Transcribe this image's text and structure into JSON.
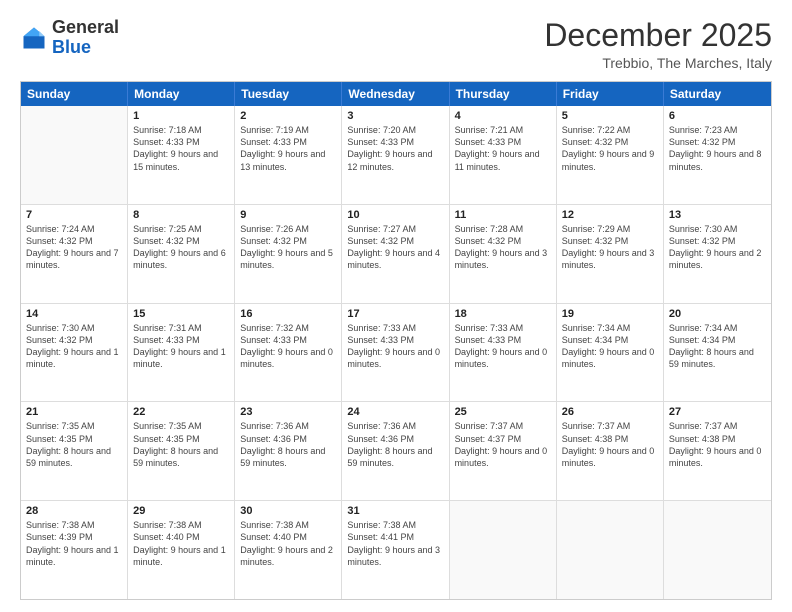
{
  "logo": {
    "general": "General",
    "blue": "Blue"
  },
  "header": {
    "month": "December 2025",
    "location": "Trebbio, The Marches, Italy"
  },
  "weekdays": [
    "Sunday",
    "Monday",
    "Tuesday",
    "Wednesday",
    "Thursday",
    "Friday",
    "Saturday"
  ],
  "weeks": [
    [
      {
        "day": "",
        "sunrise": "",
        "sunset": "",
        "daylight": ""
      },
      {
        "day": "1",
        "sunrise": "Sunrise: 7:18 AM",
        "sunset": "Sunset: 4:33 PM",
        "daylight": "Daylight: 9 hours and 15 minutes."
      },
      {
        "day": "2",
        "sunrise": "Sunrise: 7:19 AM",
        "sunset": "Sunset: 4:33 PM",
        "daylight": "Daylight: 9 hours and 13 minutes."
      },
      {
        "day": "3",
        "sunrise": "Sunrise: 7:20 AM",
        "sunset": "Sunset: 4:33 PM",
        "daylight": "Daylight: 9 hours and 12 minutes."
      },
      {
        "day": "4",
        "sunrise": "Sunrise: 7:21 AM",
        "sunset": "Sunset: 4:33 PM",
        "daylight": "Daylight: 9 hours and 11 minutes."
      },
      {
        "day": "5",
        "sunrise": "Sunrise: 7:22 AM",
        "sunset": "Sunset: 4:32 PM",
        "daylight": "Daylight: 9 hours and 9 minutes."
      },
      {
        "day": "6",
        "sunrise": "Sunrise: 7:23 AM",
        "sunset": "Sunset: 4:32 PM",
        "daylight": "Daylight: 9 hours and 8 minutes."
      }
    ],
    [
      {
        "day": "7",
        "sunrise": "Sunrise: 7:24 AM",
        "sunset": "Sunset: 4:32 PM",
        "daylight": "Daylight: 9 hours and 7 minutes."
      },
      {
        "day": "8",
        "sunrise": "Sunrise: 7:25 AM",
        "sunset": "Sunset: 4:32 PM",
        "daylight": "Daylight: 9 hours and 6 minutes."
      },
      {
        "day": "9",
        "sunrise": "Sunrise: 7:26 AM",
        "sunset": "Sunset: 4:32 PM",
        "daylight": "Daylight: 9 hours and 5 minutes."
      },
      {
        "day": "10",
        "sunrise": "Sunrise: 7:27 AM",
        "sunset": "Sunset: 4:32 PM",
        "daylight": "Daylight: 9 hours and 4 minutes."
      },
      {
        "day": "11",
        "sunrise": "Sunrise: 7:28 AM",
        "sunset": "Sunset: 4:32 PM",
        "daylight": "Daylight: 9 hours and 3 minutes."
      },
      {
        "day": "12",
        "sunrise": "Sunrise: 7:29 AM",
        "sunset": "Sunset: 4:32 PM",
        "daylight": "Daylight: 9 hours and 3 minutes."
      },
      {
        "day": "13",
        "sunrise": "Sunrise: 7:30 AM",
        "sunset": "Sunset: 4:32 PM",
        "daylight": "Daylight: 9 hours and 2 minutes."
      }
    ],
    [
      {
        "day": "14",
        "sunrise": "Sunrise: 7:30 AM",
        "sunset": "Sunset: 4:32 PM",
        "daylight": "Daylight: 9 hours and 1 minute."
      },
      {
        "day": "15",
        "sunrise": "Sunrise: 7:31 AM",
        "sunset": "Sunset: 4:33 PM",
        "daylight": "Daylight: 9 hours and 1 minute."
      },
      {
        "day": "16",
        "sunrise": "Sunrise: 7:32 AM",
        "sunset": "Sunset: 4:33 PM",
        "daylight": "Daylight: 9 hours and 0 minutes."
      },
      {
        "day": "17",
        "sunrise": "Sunrise: 7:33 AM",
        "sunset": "Sunset: 4:33 PM",
        "daylight": "Daylight: 9 hours and 0 minutes."
      },
      {
        "day": "18",
        "sunrise": "Sunrise: 7:33 AM",
        "sunset": "Sunset: 4:33 PM",
        "daylight": "Daylight: 9 hours and 0 minutes."
      },
      {
        "day": "19",
        "sunrise": "Sunrise: 7:34 AM",
        "sunset": "Sunset: 4:34 PM",
        "daylight": "Daylight: 9 hours and 0 minutes."
      },
      {
        "day": "20",
        "sunrise": "Sunrise: 7:34 AM",
        "sunset": "Sunset: 4:34 PM",
        "daylight": "Daylight: 8 hours and 59 minutes."
      }
    ],
    [
      {
        "day": "21",
        "sunrise": "Sunrise: 7:35 AM",
        "sunset": "Sunset: 4:35 PM",
        "daylight": "Daylight: 8 hours and 59 minutes."
      },
      {
        "day": "22",
        "sunrise": "Sunrise: 7:35 AM",
        "sunset": "Sunset: 4:35 PM",
        "daylight": "Daylight: 8 hours and 59 minutes."
      },
      {
        "day": "23",
        "sunrise": "Sunrise: 7:36 AM",
        "sunset": "Sunset: 4:36 PM",
        "daylight": "Daylight: 8 hours and 59 minutes."
      },
      {
        "day": "24",
        "sunrise": "Sunrise: 7:36 AM",
        "sunset": "Sunset: 4:36 PM",
        "daylight": "Daylight: 8 hours and 59 minutes."
      },
      {
        "day": "25",
        "sunrise": "Sunrise: 7:37 AM",
        "sunset": "Sunset: 4:37 PM",
        "daylight": "Daylight: 9 hours and 0 minutes."
      },
      {
        "day": "26",
        "sunrise": "Sunrise: 7:37 AM",
        "sunset": "Sunset: 4:38 PM",
        "daylight": "Daylight: 9 hours and 0 minutes."
      },
      {
        "day": "27",
        "sunrise": "Sunrise: 7:37 AM",
        "sunset": "Sunset: 4:38 PM",
        "daylight": "Daylight: 9 hours and 0 minutes."
      }
    ],
    [
      {
        "day": "28",
        "sunrise": "Sunrise: 7:38 AM",
        "sunset": "Sunset: 4:39 PM",
        "daylight": "Daylight: 9 hours and 1 minute."
      },
      {
        "day": "29",
        "sunrise": "Sunrise: 7:38 AM",
        "sunset": "Sunset: 4:40 PM",
        "daylight": "Daylight: 9 hours and 1 minute."
      },
      {
        "day": "30",
        "sunrise": "Sunrise: 7:38 AM",
        "sunset": "Sunset: 4:40 PM",
        "daylight": "Daylight: 9 hours and 2 minutes."
      },
      {
        "day": "31",
        "sunrise": "Sunrise: 7:38 AM",
        "sunset": "Sunset: 4:41 PM",
        "daylight": "Daylight: 9 hours and 3 minutes."
      },
      {
        "day": "",
        "sunrise": "",
        "sunset": "",
        "daylight": ""
      },
      {
        "day": "",
        "sunrise": "",
        "sunset": "",
        "daylight": ""
      },
      {
        "day": "",
        "sunrise": "",
        "sunset": "",
        "daylight": ""
      }
    ]
  ]
}
